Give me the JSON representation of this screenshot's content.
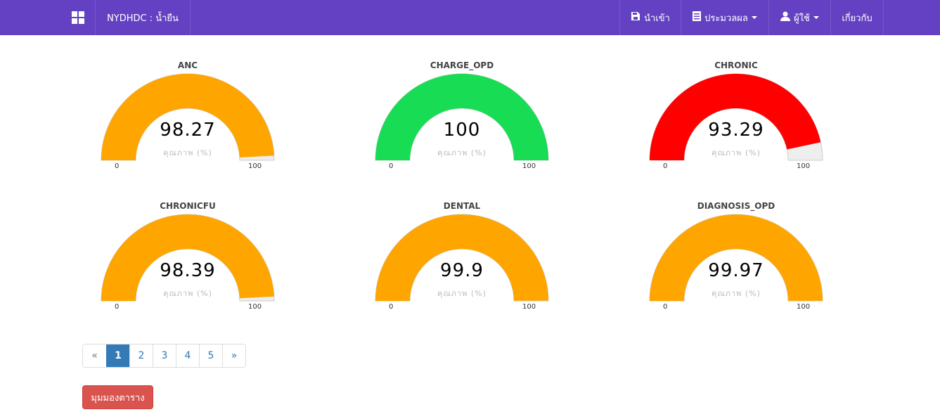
{
  "navbar": {
    "app_title": "NYDHDC : น้ำยืน",
    "import_label": "นำเข้า",
    "process_label": "ประมวลผล",
    "user_label": "ผู้ใช้",
    "about_label": "เกี่ยวกับ",
    "background_color": "#6441c3"
  },
  "gauges": [
    {
      "title": "ANC",
      "value": 98.27,
      "value_text": "98.27",
      "unit": "คุณภาพ (%)",
      "min": "0",
      "max": "100",
      "color": "#ffa500"
    },
    {
      "title": "CHARGE_OPD",
      "value": 100,
      "value_text": "100",
      "unit": "คุณภาพ (%)",
      "min": "0",
      "max": "100",
      "color": "#17dc54"
    },
    {
      "title": "CHRONIC",
      "value": 93.29,
      "value_text": "93.29",
      "unit": "คุณภาพ (%)",
      "min": "0",
      "max": "100",
      "color": "#ff0000"
    },
    {
      "title": "CHRONICFU",
      "value": 98.39,
      "value_text": "98.39",
      "unit": "คุณภาพ (%)",
      "min": "0",
      "max": "100",
      "color": "#ffa500"
    },
    {
      "title": "DENTAL",
      "value": 99.9,
      "value_text": "99.9",
      "unit": "คุณภาพ (%)",
      "min": "0",
      "max": "100",
      "color": "#ffa500"
    },
    {
      "title": "DIAGNOSIS_OPD",
      "value": 99.97,
      "value_text": "99.97",
      "unit": "คุณภาพ (%)",
      "min": "0",
      "max": "100",
      "color": "#ffa500"
    }
  ],
  "gauge_track_color": "#eeeeee",
  "pagination": {
    "prev": "«",
    "next": "»",
    "pages": [
      "1",
      "2",
      "3",
      "4",
      "5"
    ],
    "active_page": "1"
  },
  "table_view_button": "มุมมองตาราง"
}
